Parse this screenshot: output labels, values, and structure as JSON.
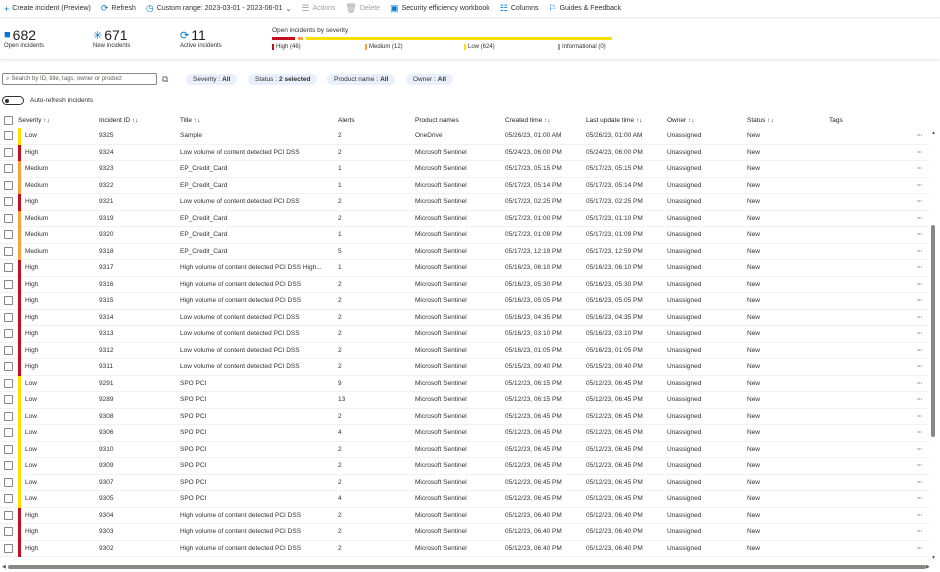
{
  "toolbar": {
    "create": "Create incident (Preview)",
    "refresh": "Refresh",
    "range": "Custom range: 2023-03-01 - 2023-06-01",
    "actions": "Actions",
    "delete": "Delete",
    "workbook": "Security efficiency workbook",
    "columns": "Columns",
    "guides": "Guides & Feedback"
  },
  "stats": {
    "open": {
      "value": "682",
      "label": "Open incidents"
    },
    "new": {
      "value": "671",
      "label": "New incidents"
    },
    "active": {
      "value": "11",
      "label": "Active incidents"
    }
  },
  "severity_summary": {
    "title": "Open incidents by severity",
    "items": [
      {
        "label": "High (46)",
        "count": 46,
        "color": "#c50f1f"
      },
      {
        "label": "Medium (12)",
        "count": 12,
        "color": "#f7a23b"
      },
      {
        "label": "Low (624)",
        "count": 624,
        "color": "#fce100"
      },
      {
        "label": "Informational (0)",
        "count": 0,
        "color": "#a19f9d"
      }
    ]
  },
  "filters": {
    "search_placeholder": "Search by ID, title, tags, owner or product",
    "severity": {
      "name": "Severity :",
      "value": "All"
    },
    "status": {
      "name": "Status :",
      "value": "2 selected"
    },
    "product": {
      "name": "Product name :",
      "value": "All"
    },
    "owner": {
      "name": "Owner :",
      "value": "All"
    }
  },
  "auto_refresh": {
    "label": "Auto-refresh incidents",
    "on": false
  },
  "columns": {
    "severity": "Severity ↑↓",
    "id": "Incident ID ↑↓",
    "title": "Title ↑↓",
    "alerts": "Alerts",
    "product": "Product names",
    "created": "Created time ↑↓",
    "updated": "Last update time ↑↓",
    "owner": "Owner ↑↓",
    "status": "Status ↑↓",
    "tags": "Tags"
  },
  "severity_colors": {
    "High": "#c50f1f",
    "Medium": "#f7a23b",
    "Low": "#fce100"
  },
  "rows": [
    {
      "severity": "Low",
      "id": "9325",
      "title": "Sample",
      "alerts": "2",
      "product": "OneDrive",
      "created": "05/26/23, 01:00 AM",
      "updated": "05/26/23, 01:00 AM",
      "owner": "Unassigned",
      "status": "New"
    },
    {
      "severity": "High",
      "id": "9324",
      "title": "Low volume of content detected PCI DSS",
      "alerts": "2",
      "product": "Microsoft Sentinel",
      "created": "05/24/23, 06:00 PM",
      "updated": "05/24/23, 06:00 PM",
      "owner": "Unassigned",
      "status": "New"
    },
    {
      "severity": "Medium",
      "id": "9323",
      "title": "EP_Credit_Card",
      "alerts": "1",
      "product": "Microsoft Sentinel",
      "created": "05/17/23, 05:15 PM",
      "updated": "05/17/23, 05:15 PM",
      "owner": "Unassigned",
      "status": "New"
    },
    {
      "severity": "Medium",
      "id": "9322",
      "title": "EP_Credit_Card",
      "alerts": "1",
      "product": "Microsoft Sentinel",
      "created": "05/17/23, 05:14 PM",
      "updated": "05/17/23, 05:14 PM",
      "owner": "Unassigned",
      "status": "New"
    },
    {
      "severity": "High",
      "id": "9321",
      "title": "Low volume of content detected PCI DSS",
      "alerts": "2",
      "product": "Microsoft Sentinel",
      "created": "05/17/23, 02:25 PM",
      "updated": "05/17/23, 02:25 PM",
      "owner": "Unassigned",
      "status": "New"
    },
    {
      "severity": "Medium",
      "id": "9319",
      "title": "EP_Credit_Card",
      "alerts": "2",
      "product": "Microsoft Sentinel",
      "created": "05/17/23, 01:00 PM",
      "updated": "05/17/23, 01:10 PM",
      "owner": "Unassigned",
      "status": "New"
    },
    {
      "severity": "Medium",
      "id": "9320",
      "title": "EP_Credit_Card",
      "alerts": "1",
      "product": "Microsoft Sentinel",
      "created": "05/17/23, 01:09 PM",
      "updated": "05/17/23, 01:09 PM",
      "owner": "Unassigned",
      "status": "New"
    },
    {
      "severity": "Medium",
      "id": "9318",
      "title": "EP_Credit_Card",
      "alerts": "5",
      "product": "Microsoft Sentinel",
      "created": "05/17/23, 12:19 PM",
      "updated": "05/17/23, 12:59 PM",
      "owner": "Unassigned",
      "status": "New"
    },
    {
      "severity": "High",
      "id": "9317",
      "title": "High volume of content detected PCI DSS High...",
      "alerts": "1",
      "product": "Microsoft Sentinel",
      "created": "05/16/23, 06:10 PM",
      "updated": "05/16/23, 06:10 PM",
      "owner": "Unassigned",
      "status": "New"
    },
    {
      "severity": "High",
      "id": "9316",
      "title": "High volume of content detected PCI DSS",
      "alerts": "2",
      "product": "Microsoft Sentinel",
      "created": "05/16/23, 05:30 PM",
      "updated": "05/16/23, 05:30 PM",
      "owner": "Unassigned",
      "status": "New"
    },
    {
      "severity": "High",
      "id": "9315",
      "title": "High volume of content detected PCI DSS",
      "alerts": "2",
      "product": "Microsoft Sentinel",
      "created": "05/16/23, 05:05 PM",
      "updated": "05/16/23, 05:05 PM",
      "owner": "Unassigned",
      "status": "New"
    },
    {
      "severity": "High",
      "id": "9314",
      "title": "Low volume of content detected PCI DSS",
      "alerts": "2",
      "product": "Microsoft Sentinel",
      "created": "05/16/23, 04:35 PM",
      "updated": "05/16/23, 04:35 PM",
      "owner": "Unassigned",
      "status": "New"
    },
    {
      "severity": "High",
      "id": "9313",
      "title": "Low volume of content detected PCI DSS",
      "alerts": "2",
      "product": "Microsoft Sentinel",
      "created": "05/16/23, 03:10 PM",
      "updated": "05/16/23, 03:10 PM",
      "owner": "Unassigned",
      "status": "New"
    },
    {
      "severity": "High",
      "id": "9312",
      "title": "Low volume of content detected PCI DSS",
      "alerts": "2",
      "product": "Microsoft Sentinel",
      "created": "05/16/23, 01:05 PM",
      "updated": "05/16/23, 01:05 PM",
      "owner": "Unassigned",
      "status": "New"
    },
    {
      "severity": "High",
      "id": "9311",
      "title": "Low volume of content detected PCI DSS",
      "alerts": "2",
      "product": "Microsoft Sentinel",
      "created": "05/15/23, 09:40 PM",
      "updated": "05/15/23, 09:40 PM",
      "owner": "Unassigned",
      "status": "New"
    },
    {
      "severity": "Low",
      "id": "9291",
      "title": "SPO PCI",
      "alerts": "9",
      "product": "Microsoft Sentinel",
      "created": "05/12/23, 06:15 PM",
      "updated": "05/12/23, 06:45 PM",
      "owner": "Unassigned",
      "status": "New"
    },
    {
      "severity": "Low",
      "id": "9289",
      "title": "SPO PCI",
      "alerts": "13",
      "product": "Microsoft Sentinel",
      "created": "05/12/23, 06:15 PM",
      "updated": "05/12/23, 06:45 PM",
      "owner": "Unassigned",
      "status": "New"
    },
    {
      "severity": "Low",
      "id": "9308",
      "title": "SPO PCI",
      "alerts": "2",
      "product": "Microsoft Sentinel",
      "created": "05/12/23, 06:45 PM",
      "updated": "05/12/23, 06:45 PM",
      "owner": "Unassigned",
      "status": "New"
    },
    {
      "severity": "Low",
      "id": "9306",
      "title": "SPO PCI",
      "alerts": "4",
      "product": "Microsoft Sentinel",
      "created": "05/12/23, 06:45 PM",
      "updated": "05/12/23, 06:45 PM",
      "owner": "Unassigned",
      "status": "New"
    },
    {
      "severity": "Low",
      "id": "9310",
      "title": "SPO PCI",
      "alerts": "2",
      "product": "Microsoft Sentinel",
      "created": "05/12/23, 06:45 PM",
      "updated": "05/12/23, 06:45 PM",
      "owner": "Unassigned",
      "status": "New"
    },
    {
      "severity": "Low",
      "id": "9309",
      "title": "SPO PCI",
      "alerts": "2",
      "product": "Microsoft Sentinel",
      "created": "05/12/23, 06:45 PM",
      "updated": "05/12/23, 06:45 PM",
      "owner": "Unassigned",
      "status": "New"
    },
    {
      "severity": "Low",
      "id": "9307",
      "title": "SPO PCI",
      "alerts": "2",
      "product": "Microsoft Sentinel",
      "created": "05/12/23, 06:45 PM",
      "updated": "05/12/23, 06:45 PM",
      "owner": "Unassigned",
      "status": "New"
    },
    {
      "severity": "Low",
      "id": "9305",
      "title": "SPO PCI",
      "alerts": "4",
      "product": "Microsoft Sentinel",
      "created": "05/12/23, 06:45 PM",
      "updated": "05/12/23, 06:45 PM",
      "owner": "Unassigned",
      "status": "New"
    },
    {
      "severity": "High",
      "id": "9304",
      "title": "High volume of content detected PCI DSS",
      "alerts": "2",
      "product": "Microsoft Sentinel",
      "created": "05/12/23, 06:40 PM",
      "updated": "05/12/23, 06:40 PM",
      "owner": "Unassigned",
      "status": "New"
    },
    {
      "severity": "High",
      "id": "9303",
      "title": "High volume of content detected PCI DSS",
      "alerts": "2",
      "product": "Microsoft Sentinel",
      "created": "05/12/23, 06:40 PM",
      "updated": "05/12/23, 06:40 PM",
      "owner": "Unassigned",
      "status": "New"
    },
    {
      "severity": "High",
      "id": "9302",
      "title": "High volume of content detected PCI DSS",
      "alerts": "2",
      "product": "Microsoft Sentinel",
      "created": "05/12/23, 06:40 PM",
      "updated": "05/12/23, 06:40 PM",
      "owner": "Unassigned",
      "status": "New"
    }
  ]
}
